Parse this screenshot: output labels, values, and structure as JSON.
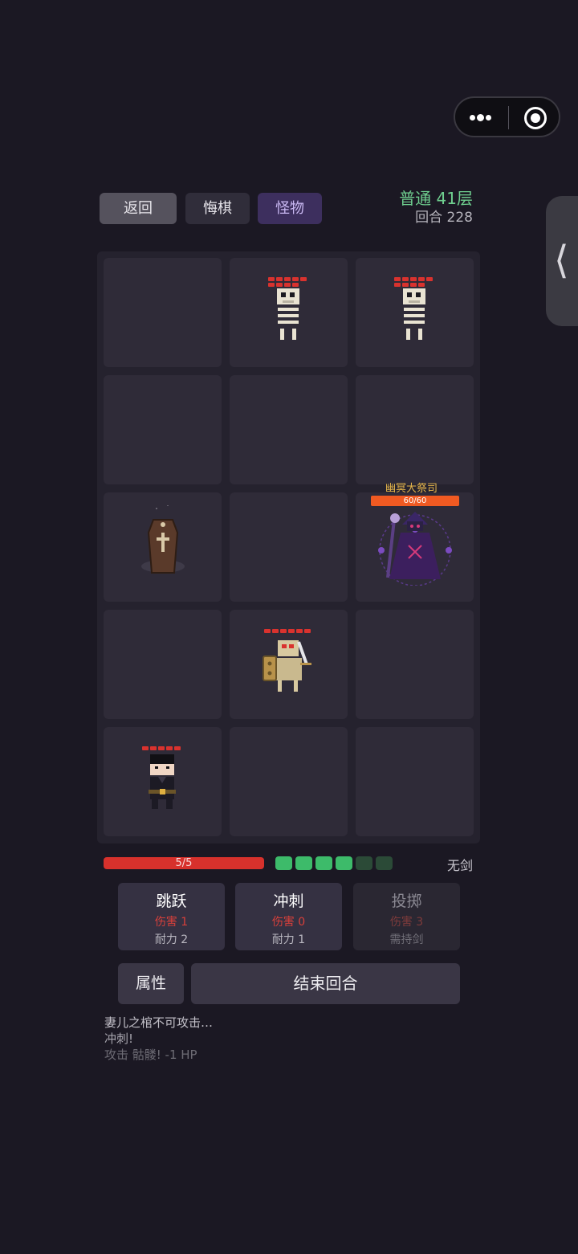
{
  "top_buttons": {
    "back": "返回",
    "undo": "悔棋",
    "monster": "怪物"
  },
  "level": "普通 41层",
  "turn": "回合 228",
  "boss": {
    "name": "幽冥大祭司",
    "hp_text": "60/60"
  },
  "player": {
    "hp_text": "5/5",
    "hp_fraction": 1.0,
    "stamina_total": 6,
    "stamina_current": 4,
    "sword_status": "无剑"
  },
  "actions": [
    {
      "name": "跳跃",
      "damage": "伤害 1",
      "cost": "耐力 2",
      "enabled": true
    },
    {
      "name": "冲刺",
      "damage": "伤害 0",
      "cost": "耐力 1",
      "enabled": true
    },
    {
      "name": "投掷",
      "damage": "伤害 3",
      "cost": "需持剑",
      "enabled": false
    }
  ],
  "attr_button": "属性",
  "end_turn_button": "结束回合",
  "log": [
    "妻儿之棺不可攻击…",
    "冲刺!",
    "攻击 骷髅! -1 HP"
  ],
  "colors": {
    "background": "#1b1823",
    "hp_red": "#d7312c",
    "stamina_full": "#3dbb6a",
    "stamina_empty": "#2b4a37",
    "boss_hp": "#f05a22",
    "level_green": "#6fcf8f"
  },
  "board_units": [
    {
      "cell": "r1c2",
      "type": "skeleton-icon",
      "hp_pips": 9
    },
    {
      "cell": "r1c3",
      "type": "skeleton-icon",
      "hp_pips": 9
    },
    {
      "cell": "r3c1",
      "type": "coffin-icon"
    },
    {
      "cell": "r3c3",
      "type": "dark-priest-boss-icon"
    },
    {
      "cell": "r4c2",
      "type": "skeleton-knight-icon",
      "hp_pips": 6
    },
    {
      "cell": "r5c1",
      "type": "player-hero-icon",
      "hp_pips": 5
    }
  ]
}
